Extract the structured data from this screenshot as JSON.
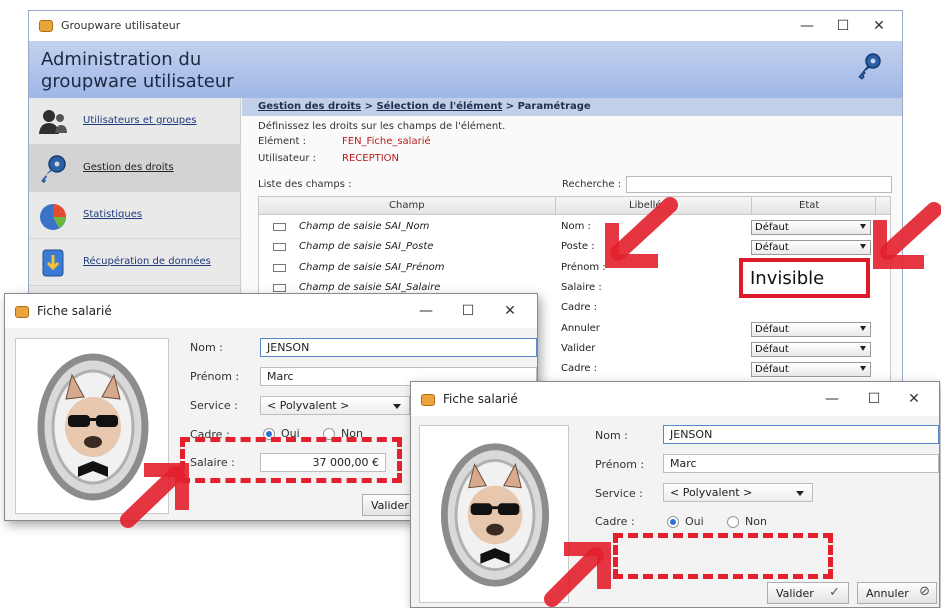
{
  "main_window": {
    "title": "Groupware utilisateur",
    "header_title": "Administration du groupware utilisateur",
    "minimize": "—",
    "maximize": "☐",
    "close": "✕",
    "breadcrumb": {
      "part1": "Gestion des droits",
      "sep1": " > ",
      "part2": "Sélection de l'élément",
      "sep2": " > ",
      "part3": "Paramétrage"
    },
    "sidebar": [
      {
        "label": "Utilisateurs et groupes",
        "icon": "users-icon"
      },
      {
        "label": "Gestion des droits",
        "icon": "key-icon"
      },
      {
        "label": "Statistiques",
        "icon": "pie-chart-icon"
      },
      {
        "label": "Récupération de données",
        "icon": "download-icon"
      }
    ],
    "intro": "Définissez les droits sur les champs de l'élément.",
    "element_label": "Elément :",
    "element_value": "FEN_Fiche_salarié",
    "user_label": "Utilisateur :",
    "user_value": "RECEPTION",
    "list_label": "Liste des champs :",
    "search_label": "Recherche :",
    "grid_headers": {
      "champ": "Champ",
      "libelle": "Libellé",
      "etat": "Etat"
    },
    "rows": [
      {
        "champ": "Champ de saisie SAI_Nom",
        "libelle": "Nom :",
        "etat": "Défaut"
      },
      {
        "champ": "Champ de saisie SAI_Poste",
        "libelle": "Poste :",
        "etat": "Défaut"
      },
      {
        "champ": "Champ de saisie SAI_Prénom",
        "libelle": "Prénom :",
        "etat": ""
      },
      {
        "champ": "Champ de saisie SAI_Salaire",
        "libelle": "Salaire :",
        "etat": ""
      },
      {
        "champ": "",
        "libelle": "Cadre :",
        "etat": ""
      },
      {
        "champ": "",
        "libelle": "Annuler",
        "etat": "Défaut"
      },
      {
        "champ": "",
        "libelle": "Valider",
        "etat": "Défaut"
      },
      {
        "champ": "",
        "libelle": "Cadre :",
        "etat": "Défaut"
      },
      {
        "champ": "",
        "libelle": "",
        "etat": "Défaut"
      }
    ],
    "invisible_value": "Invisible"
  },
  "fiche1": {
    "title": "Fiche salarié",
    "nom_label": "Nom :",
    "nom_value": "JENSON",
    "prenom_label": "Prénom :",
    "prenom_value": "Marc",
    "service_label": "Service :",
    "service_value": "< Polyvalent >",
    "cadre_label": "Cadre :",
    "oui": "Oui",
    "non": "Non",
    "salaire_label": "Salaire :",
    "salaire_value": "37 000,00 €",
    "valider": "Valider"
  },
  "fiche2": {
    "title": "Fiche salarié",
    "nom_label": "Nom :",
    "nom_value": "JENSON",
    "prenom_label": "Prénom :",
    "prenom_value": "Marc",
    "service_label": "Service :",
    "service_value": "< Polyvalent >",
    "cadre_label": "Cadre :",
    "oui": "Oui",
    "non": "Non",
    "valider": "Valider",
    "annuler": "Annuler"
  },
  "colors": {
    "accent_red": "#e3202c",
    "header_blue": "#a8bde8",
    "link_blue": "#1f3a7a"
  }
}
